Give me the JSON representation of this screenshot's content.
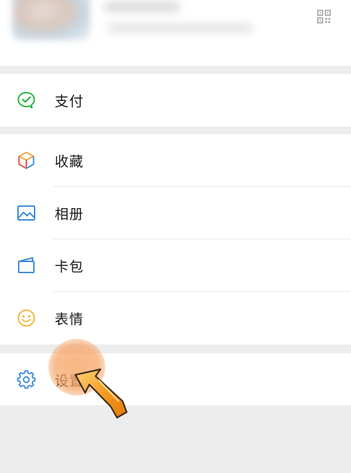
{
  "header": {
    "qr_icon": "qr-code-icon"
  },
  "menu": {
    "pay": {
      "label": "支付",
      "icon": "wechat-pay-icon",
      "color": "#22b43a"
    },
    "favorites": {
      "label": "收藏",
      "icon": "cube-icon",
      "colors": [
        "#f2a93b",
        "#e8514a",
        "#3d8fe0"
      ]
    },
    "album": {
      "label": "相册",
      "icon": "photo-icon",
      "color": "#3b8ad9"
    },
    "cards": {
      "label": "卡包",
      "icon": "wallet-icon",
      "color": "#3b8ad9"
    },
    "stickers": {
      "label": "表情",
      "icon": "smiley-icon",
      "color": "#f5b53a"
    },
    "settings": {
      "label": "设置",
      "icon": "gear-icon",
      "color": "#3b8ad9"
    }
  },
  "annotation": {
    "highlight_color": "#f5a05f",
    "pointer_icon": "pointer-arrow-icon"
  }
}
